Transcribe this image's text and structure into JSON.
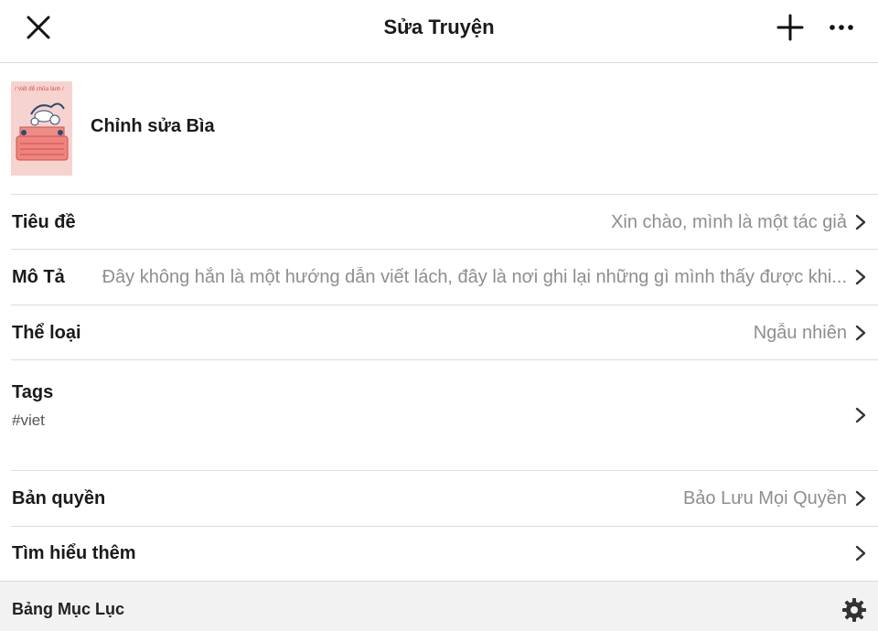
{
  "header": {
    "title": "Sửa Truyện",
    "close_icon": "close-icon",
    "add_icon": "plus-icon",
    "more_icon": "more-horizontal-icon"
  },
  "cover": {
    "caption": "/ Viết để chữa lành /",
    "edit_label": "Chỉnh sửa Bìa"
  },
  "rows": {
    "title": {
      "label": "Tiêu đề",
      "value": "Xin chào, mình là một tác giả"
    },
    "description": {
      "label": "Mô Tả",
      "value": "Đây không hẳn là một hướng dẫn viết lách, đây là nơi ghi lại những gì mình thấy được khi..."
    },
    "category": {
      "label": "Thể loại",
      "value": "Ngẫu nhiên"
    },
    "tags": {
      "label": "Tags",
      "value": "#viet"
    },
    "copyright": {
      "label": "Bản quyền",
      "value": "Bảo Lưu Mọi Quyền"
    },
    "learn_more": {
      "label": "Tìm hiểu thêm"
    }
  },
  "footer": {
    "label": "Bảng Mục Lục",
    "settings_icon": "gear-icon"
  },
  "colors": {
    "text": "#1a1a1a",
    "muted": "#8e8e8e",
    "divider": "#dcdcdc",
    "footer_bg": "#f2f2f2",
    "cover_bg": "#f6d3cf"
  }
}
